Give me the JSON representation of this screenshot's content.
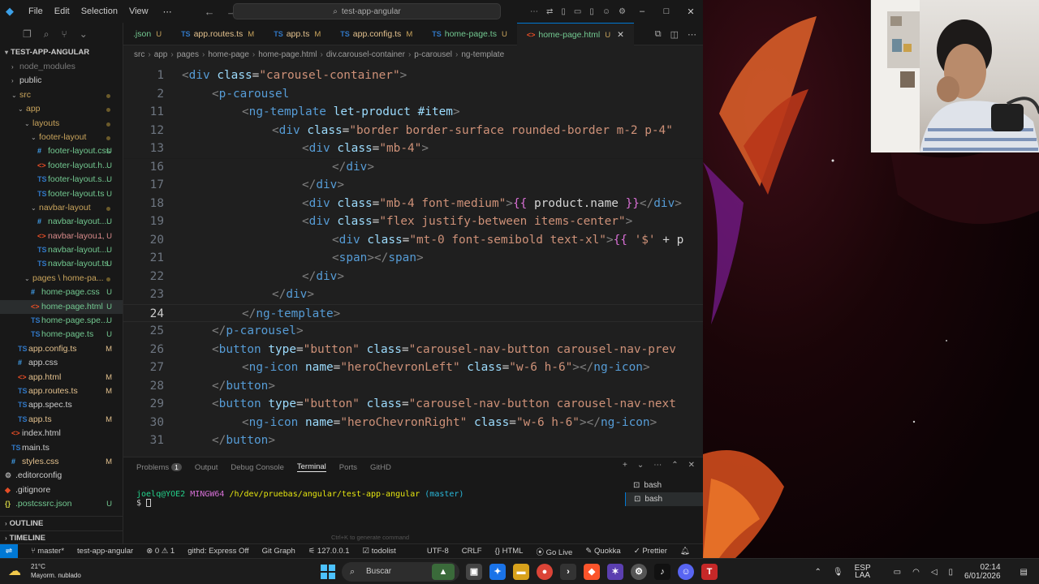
{
  "titlebar": {
    "menu": [
      "File",
      "Edit",
      "Selection",
      "View"
    ],
    "search_text": "test-app-angular"
  },
  "explorer": {
    "root_label": "TEST-APP-ANGULAR",
    "items": [
      {
        "label": "node_modules",
        "depth": 1,
        "kind": "folder",
        "open": false,
        "muted": true
      },
      {
        "label": "public",
        "depth": 1,
        "kind": "folder",
        "open": false
      },
      {
        "label": "src",
        "depth": 1,
        "kind": "folder",
        "open": true,
        "dot": true
      },
      {
        "label": "app",
        "depth": 2,
        "kind": "folder",
        "open": true,
        "dot": true
      },
      {
        "label": "layouts",
        "depth": 3,
        "kind": "folder",
        "open": true,
        "dot": true
      },
      {
        "label": "footer-layout",
        "depth": 4,
        "kind": "folder",
        "open": true,
        "dot": true
      },
      {
        "label": "footer-layout.css",
        "depth": 5,
        "kind": "css",
        "status": "U"
      },
      {
        "label": "footer-layout.h...",
        "depth": 5,
        "kind": "html",
        "status": "U"
      },
      {
        "label": "footer-layout.s...",
        "depth": 5,
        "kind": "ts",
        "status": "U"
      },
      {
        "label": "footer-layout.ts",
        "depth": 5,
        "kind": "ts",
        "status": "U"
      },
      {
        "label": "navbar-layout",
        "depth": 4,
        "kind": "folder",
        "open": true,
        "dot": true
      },
      {
        "label": "navbar-layout....",
        "depth": 5,
        "kind": "css",
        "status": "U"
      },
      {
        "label": "navbar-layou...",
        "depth": 5,
        "kind": "html",
        "status": "1, U"
      },
      {
        "label": "navbar-layout....",
        "depth": 5,
        "kind": "ts",
        "status": "U"
      },
      {
        "label": "navbar-layout.ts",
        "depth": 5,
        "kind": "ts",
        "status": "U"
      },
      {
        "label": "pages \\ home-pa...",
        "depth": 3,
        "kind": "folder",
        "open": true,
        "dot": true
      },
      {
        "label": "home-page.css",
        "depth": 4,
        "kind": "css",
        "status": "U"
      },
      {
        "label": "home-page.html",
        "depth": 4,
        "kind": "html",
        "status": "U",
        "selected": true
      },
      {
        "label": "home-page.spe...",
        "depth": 4,
        "kind": "ts",
        "status": "U"
      },
      {
        "label": "home-page.ts",
        "depth": 4,
        "kind": "ts",
        "status": "U"
      },
      {
        "label": "app.config.ts",
        "depth": 2,
        "kind": "ts",
        "status": "M"
      },
      {
        "label": "app.css",
        "depth": 2,
        "kind": "css",
        "status": ""
      },
      {
        "label": "app.html",
        "depth": 2,
        "kind": "html",
        "status": "M"
      },
      {
        "label": "app.routes.ts",
        "depth": 2,
        "kind": "ts",
        "status": "M"
      },
      {
        "label": "app.spec.ts",
        "depth": 2,
        "kind": "ts",
        "status": ""
      },
      {
        "label": "app.ts",
        "depth": 2,
        "kind": "ts",
        "status": "M"
      },
      {
        "label": "index.html",
        "depth": 1,
        "kind": "html",
        "status": ""
      },
      {
        "label": "main.ts",
        "depth": 1,
        "kind": "ts",
        "status": ""
      },
      {
        "label": "styles.css",
        "depth": 1,
        "kind": "css",
        "status": "M"
      },
      {
        "label": ".editorconfig",
        "depth": 0,
        "kind": "gear",
        "status": ""
      },
      {
        "label": ".gitignore",
        "depth": 0,
        "kind": "git",
        "status": ""
      },
      {
        "label": ".postcssrc.json",
        "depth": 0,
        "kind": "json",
        "status": "U"
      }
    ],
    "outline_label": "OUTLINE",
    "timeline_label": "TIMELINE"
  },
  "tabs": [
    {
      "label": ".json",
      "status": "U",
      "kind": "json"
    },
    {
      "label": "app.routes.ts",
      "status": "M",
      "kind": "ts"
    },
    {
      "label": "app.ts",
      "status": "M",
      "kind": "ts"
    },
    {
      "label": "app.config.ts",
      "status": "M",
      "kind": "ts"
    },
    {
      "label": "home-page.ts",
      "status": "U",
      "kind": "ts"
    },
    {
      "label": "home-page.html",
      "status": "U",
      "kind": "html",
      "active": true
    }
  ],
  "breadcrumb": [
    "src",
    "app",
    "pages",
    "home-page",
    "home-page.html",
    "div.carousel-container",
    "p-carousel",
    "ng-template"
  ],
  "editor": {
    "current_line": "24",
    "lines": [
      {
        "n": "1",
        "indent": 0,
        "tokens": [
          [
            "tg",
            "<"
          ],
          [
            "tn",
            "div"
          ],
          [
            "tx",
            " "
          ],
          [
            "at",
            "class"
          ],
          [
            "tx",
            "="
          ],
          [
            "st",
            "\"carousel-container\""
          ],
          [
            "tg",
            ">"
          ]
        ]
      },
      {
        "n": "2",
        "indent": 1,
        "tokens": [
          [
            "tg",
            "<"
          ],
          [
            "tn",
            "p-carousel"
          ]
        ]
      },
      {
        "n": "11",
        "indent": 2,
        "tokens": [
          [
            "tg",
            "<"
          ],
          [
            "tn",
            "ng-template"
          ],
          [
            "tx",
            " "
          ],
          [
            "at",
            "let-product"
          ],
          [
            "tx",
            " "
          ],
          [
            "at",
            "#item"
          ],
          [
            "tg",
            ">"
          ]
        ]
      },
      {
        "n": "12",
        "indent": 3,
        "tokens": [
          [
            "tg",
            "<"
          ],
          [
            "tn",
            "div"
          ],
          [
            "tx",
            " "
          ],
          [
            "at",
            "class"
          ],
          [
            "tx",
            "="
          ],
          [
            "st",
            "\"border border-surface rounded-border m-2 p-4\""
          ]
        ]
      },
      {
        "n": "13",
        "indent": 4,
        "tokens": [
          [
            "tg",
            "<"
          ],
          [
            "tn",
            "div"
          ],
          [
            "tx",
            " "
          ],
          [
            "at",
            "class"
          ],
          [
            "tx",
            "="
          ],
          [
            "st",
            "\"mb-4\""
          ],
          [
            "tg",
            ">"
          ]
        ]
      },
      {
        "n": "16",
        "indent": 5,
        "tokens": [
          [
            "tg",
            "</"
          ],
          [
            "tn",
            "div"
          ],
          [
            "tg",
            ">"
          ]
        ]
      },
      {
        "n": "17",
        "indent": 4,
        "tokens": [
          [
            "tg",
            "</"
          ],
          [
            "tn",
            "div"
          ],
          [
            "tg",
            ">"
          ]
        ]
      },
      {
        "n": "18",
        "indent": 4,
        "tokens": [
          [
            "tg",
            "<"
          ],
          [
            "tn",
            "div"
          ],
          [
            "tx",
            " "
          ],
          [
            "at",
            "class"
          ],
          [
            "tx",
            "="
          ],
          [
            "st",
            "\"mb-4 font-medium\""
          ],
          [
            "tg",
            ">"
          ],
          [
            "br",
            "{{"
          ],
          [
            "tx",
            " product.name "
          ],
          [
            "br",
            "}}"
          ],
          [
            "tg",
            "</"
          ],
          [
            "tn",
            "div"
          ],
          [
            "tg",
            ">"
          ]
        ]
      },
      {
        "n": "19",
        "indent": 4,
        "tokens": [
          [
            "tg",
            "<"
          ],
          [
            "tn",
            "div"
          ],
          [
            "tx",
            " "
          ],
          [
            "at",
            "class"
          ],
          [
            "tx",
            "="
          ],
          [
            "st",
            "\"flex justify-between items-center\""
          ],
          [
            "tg",
            ">"
          ]
        ]
      },
      {
        "n": "20",
        "indent": 5,
        "tokens": [
          [
            "tg",
            "<"
          ],
          [
            "tn",
            "div"
          ],
          [
            "tx",
            " "
          ],
          [
            "at",
            "class"
          ],
          [
            "tx",
            "="
          ],
          [
            "st",
            "\"mt-0 font-semibold text-xl\""
          ],
          [
            "tg",
            ">"
          ],
          [
            "br",
            "{{"
          ],
          [
            "tx",
            " "
          ],
          [
            "st",
            "'$'"
          ],
          [
            "tx",
            " + p"
          ]
        ]
      },
      {
        "n": "21",
        "indent": 5,
        "tokens": [
          [
            "tg",
            "<"
          ],
          [
            "tn",
            "span"
          ],
          [
            "tg",
            "></"
          ],
          [
            "tn",
            "span"
          ],
          [
            "tg",
            ">"
          ]
        ]
      },
      {
        "n": "22",
        "indent": 4,
        "tokens": [
          [
            "tg",
            "</"
          ],
          [
            "tn",
            "div"
          ],
          [
            "tg",
            ">"
          ]
        ]
      },
      {
        "n": "23",
        "indent": 3,
        "tokens": [
          [
            "tg",
            "</"
          ],
          [
            "tn",
            "div"
          ],
          [
            "tg",
            ">"
          ]
        ]
      },
      {
        "n": "24",
        "indent": 2,
        "tokens": [
          [
            "tg",
            "</"
          ],
          [
            "tn",
            "ng-template"
          ],
          [
            "tg",
            ">"
          ]
        ]
      },
      {
        "n": "25",
        "indent": 1,
        "tokens": [
          [
            "tg",
            "</"
          ],
          [
            "tn",
            "p-carousel"
          ],
          [
            "tg",
            ">"
          ]
        ]
      },
      {
        "n": "26",
        "indent": 1,
        "tokens": [
          [
            "tg",
            "<"
          ],
          [
            "tn",
            "button"
          ],
          [
            "tx",
            " "
          ],
          [
            "at",
            "type"
          ],
          [
            "tx",
            "="
          ],
          [
            "st",
            "\"button\""
          ],
          [
            "tx",
            " "
          ],
          [
            "at",
            "class"
          ],
          [
            "tx",
            "="
          ],
          [
            "st",
            "\"carousel-nav-button carousel-nav-prev"
          ]
        ]
      },
      {
        "n": "27",
        "indent": 2,
        "tokens": [
          [
            "tg",
            "<"
          ],
          [
            "tn",
            "ng-icon"
          ],
          [
            "tx",
            " "
          ],
          [
            "at",
            "name"
          ],
          [
            "tx",
            "="
          ],
          [
            "st",
            "\"heroChevronLeft\""
          ],
          [
            "tx",
            " "
          ],
          [
            "at",
            "class"
          ],
          [
            "tx",
            "="
          ],
          [
            "st",
            "\"w-6 h-6\""
          ],
          [
            "tg",
            "></"
          ],
          [
            "tn",
            "ng-icon"
          ],
          [
            "tg",
            ">"
          ]
        ]
      },
      {
        "n": "28",
        "indent": 1,
        "tokens": [
          [
            "tg",
            "</"
          ],
          [
            "tn",
            "button"
          ],
          [
            "tg",
            ">"
          ]
        ]
      },
      {
        "n": "29",
        "indent": 1,
        "tokens": [
          [
            "tg",
            "<"
          ],
          [
            "tn",
            "button"
          ],
          [
            "tx",
            " "
          ],
          [
            "at",
            "type"
          ],
          [
            "tx",
            "="
          ],
          [
            "st",
            "\"button\""
          ],
          [
            "tx",
            " "
          ],
          [
            "at",
            "class"
          ],
          [
            "tx",
            "="
          ],
          [
            "st",
            "\"carousel-nav-button carousel-nav-next"
          ]
        ]
      },
      {
        "n": "30",
        "indent": 2,
        "tokens": [
          [
            "tg",
            "<"
          ],
          [
            "tn",
            "ng-icon"
          ],
          [
            "tx",
            " "
          ],
          [
            "at",
            "name"
          ],
          [
            "tx",
            "="
          ],
          [
            "st",
            "\"heroChevronRight\""
          ],
          [
            "tx",
            " "
          ],
          [
            "at",
            "class"
          ],
          [
            "tx",
            "="
          ],
          [
            "st",
            "\"w-6 h-6\""
          ],
          [
            "tg",
            "></"
          ],
          [
            "tn",
            "ng-icon"
          ],
          [
            "tg",
            ">"
          ]
        ]
      },
      {
        "n": "31",
        "indent": 1,
        "tokens": [
          [
            "tg",
            "</"
          ],
          [
            "tn",
            "button"
          ],
          [
            "tg",
            ">"
          ]
        ]
      }
    ]
  },
  "panel": {
    "tabs": [
      "Problems",
      "Output",
      "Debug Console",
      "Terminal",
      "Ports",
      "GitHD"
    ],
    "active_tab": "Terminal",
    "problems_count": "1",
    "terminal_user": "joelq@YOE2",
    "terminal_system": "MINGW64",
    "terminal_path": "/h/dev/pruebas/angular/test-app-angular",
    "terminal_branch": "(master)",
    "terminal_prompt": "$",
    "hint": "Ctrl+K to generate command",
    "terminals": [
      "bash",
      "bash"
    ]
  },
  "statusbar": {
    "branch": "master*",
    "project": "test-app-angular",
    "errors": "0",
    "warnings": "1",
    "githd": "githd: Express Off",
    "git_graph": "Git Graph",
    "host": "127.0.0.1",
    "todolist": "todolist",
    "encoding": "UTF-8",
    "eol": "CRLF",
    "language": "HTML",
    "go_live": "Go Live",
    "quokka": "Quokka",
    "prettier": "Prettier"
  },
  "taskbar": {
    "temperature": "21°C",
    "weather": "Mayorm. nublado",
    "search_label": "Buscar",
    "lang_top": "ESP",
    "lang_bottom": "LAA",
    "time": "02:14",
    "date": "6/01/2026"
  }
}
